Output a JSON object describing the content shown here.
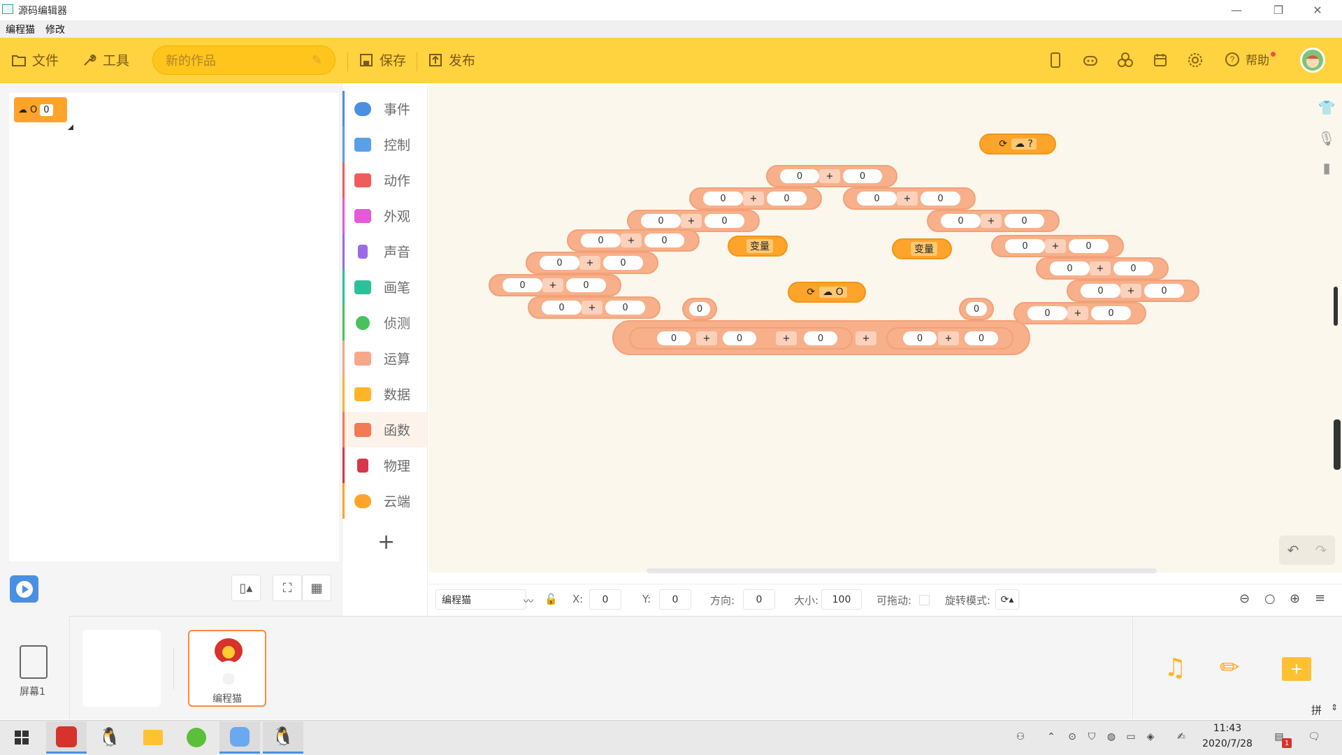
{
  "window": {
    "title": "源码编辑器",
    "minimize_label": "—",
    "restore_label": "❐",
    "close_label": "✕"
  },
  "menubar": {
    "items": [
      "编程猫",
      "修改"
    ]
  },
  "toolbar": {
    "file_label": "文件",
    "tools_label": "工具",
    "project_name": "新的作品",
    "save_label": "保存",
    "publish_label": "发布",
    "help_label": "帮助"
  },
  "stage": {
    "cloud_var_name": "O",
    "cloud_var_value": "0"
  },
  "categories": [
    {
      "label": "事件",
      "color": "#4a90e2"
    },
    {
      "label": "控制",
      "color": "#5aa0e6"
    },
    {
      "label": "动作",
      "color": "#ef5c5c"
    },
    {
      "label": "外观",
      "color": "#e45ad8"
    },
    {
      "label": "声音",
      "color": "#9b6be6"
    },
    {
      "label": "画笔",
      "color": "#2fbf9b"
    },
    {
      "label": "侦测",
      "color": "#4ac15a"
    },
    {
      "label": "运算",
      "color": "#f7a88a"
    },
    {
      "label": "数据",
      "color": "#ffb42a"
    },
    {
      "label": "函数",
      "color": "#f27a55"
    },
    {
      "label": "物理",
      "color": "#d6374a"
    },
    {
      "label": "云端",
      "color": "#ffa42a"
    }
  ],
  "canvas": {
    "num_value": "0",
    "op_symbol": "+",
    "variable_label": "变量",
    "cloud_block_top": "?",
    "cloud_block_mid": "O"
  },
  "propbar": {
    "sprite_name": "编程猫",
    "x_label": "X:",
    "x_value": "0",
    "y_label": "Y:",
    "y_value": "0",
    "direction_label": "方向:",
    "direction_value": "0",
    "size_label": "大小:",
    "size_value": "100",
    "draggable_label": "可拖动:",
    "rotation_label": "旋转模式:"
  },
  "sprites": {
    "screen_label": "屏幕1",
    "sprite_label": "编程猫"
  },
  "taskbar": {
    "time": "11:43",
    "date": "2020/7/28",
    "notification_count": "1"
  },
  "ime_label": "拼"
}
